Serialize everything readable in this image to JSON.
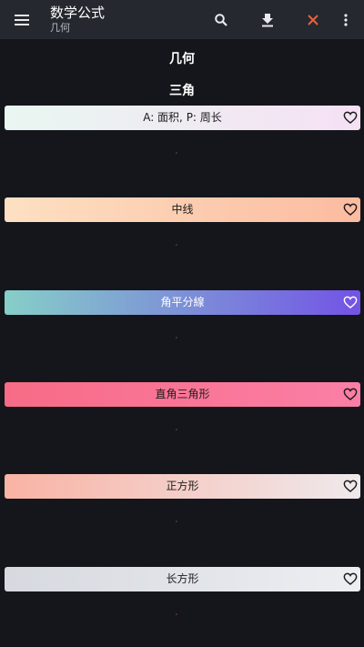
{
  "appbar": {
    "title": "数学公式",
    "subtitle": "几何",
    "icons": [
      "menu-icon",
      "search-icon",
      "download-icon",
      "close-icon",
      "more-vert-icon"
    ],
    "close_color": "#e8603c"
  },
  "section": {
    "title": "几何",
    "subtitle": "三角"
  },
  "cards": [
    {
      "label": "A: 面积, P: 周长",
      "gradient": [
        "#e9f6f1",
        "#f5e1f4"
      ]
    },
    {
      "label": "中线",
      "gradient": [
        "#fde0c2",
        "#fcbba0"
      ]
    },
    {
      "label": "角平分線",
      "gradient": [
        "#86cfc8",
        "#7353e6"
      ]
    },
    {
      "label": "直角三角形",
      "gradient": [
        "#f76b86",
        "#fb7fa6"
      ]
    },
    {
      "label": "正方形",
      "gradient": [
        "#f9b3a4",
        "#efe9ec"
      ]
    },
    {
      "label": "长方形",
      "gradient": [
        "#d6d9df",
        "#eceef2"
      ]
    }
  ],
  "formula_mark": "′"
}
